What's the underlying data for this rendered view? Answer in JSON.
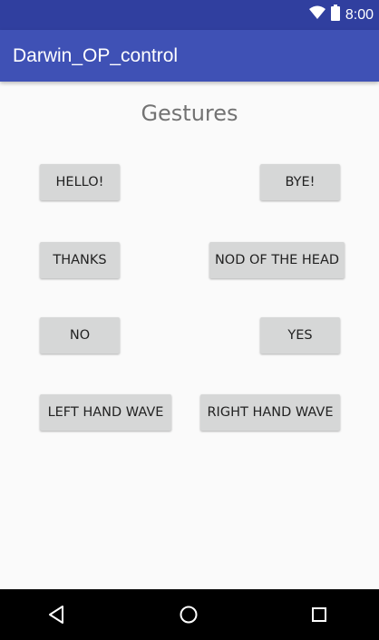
{
  "status_bar": {
    "time": "8:00",
    "icons": [
      "wifi-icon",
      "battery-icon"
    ]
  },
  "app_bar": {
    "title": "Darwin_OP_control"
  },
  "main": {
    "heading": "Gestures",
    "buttons": {
      "hello": "HELLO!",
      "bye": "BYE!",
      "thanks": "THANKS",
      "nod": "NOD OF THE HEAD",
      "no": "NO",
      "yes": "YES",
      "left_wave": "LEFT HAND WAVE",
      "right_wave": "RIGHT HAND WAVE"
    }
  },
  "nav_bar": {
    "icons": [
      "back-icon",
      "home-icon",
      "recents-icon"
    ]
  },
  "colors": {
    "status_bar": "#303f9f",
    "app_bar": "#3f51b5",
    "background": "#fafafa",
    "button": "#d6d7d7"
  }
}
